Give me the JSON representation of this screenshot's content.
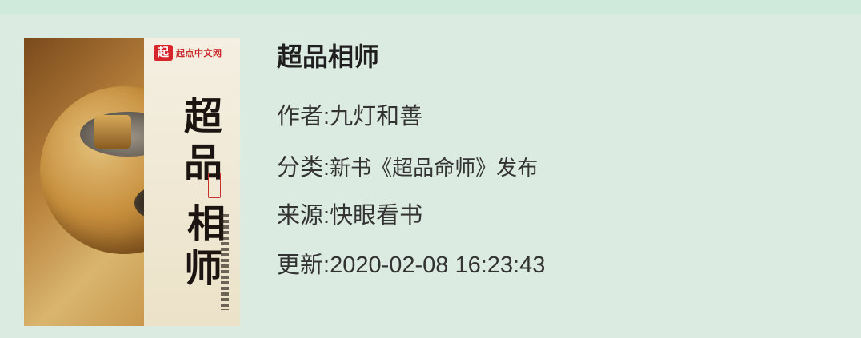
{
  "book": {
    "title": "超品相师",
    "cover": {
      "logo_text": "起点中文网",
      "logo_mark": "起",
      "title_glyphs": [
        "超",
        "品",
        "相",
        "师"
      ]
    },
    "author": {
      "label": "作者:",
      "value": "九灯和善"
    },
    "category": {
      "label": "分类:",
      "value": "新书《超品命师》发布"
    },
    "source": {
      "label": "来源:",
      "value": "快眼看书"
    },
    "updated": {
      "label": "更新:",
      "value": "2020-02-08 16:23:43"
    }
  },
  "colors": {
    "background": "#dcebe1",
    "top_strip": "#cfeadb",
    "text_primary": "#1f1f1f",
    "text_secondary": "#333333"
  }
}
